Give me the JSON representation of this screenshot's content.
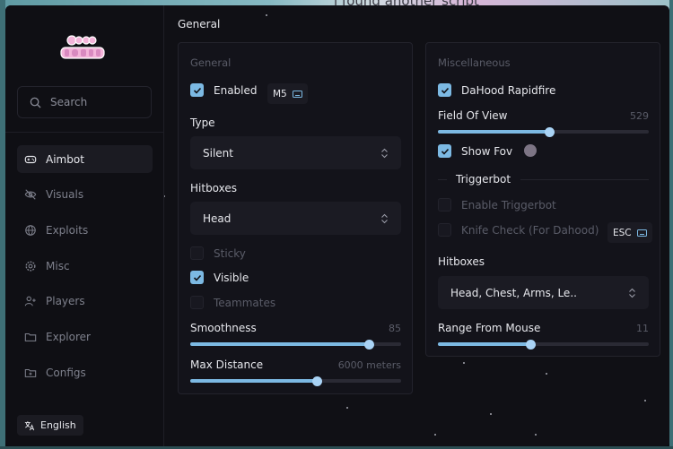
{
  "backdrop": {
    "text": "i found another script"
  },
  "sidebar": {
    "search_placeholder": "Search",
    "items": [
      {
        "label": "Aimbot",
        "icon": "gamepad-icon",
        "active": true
      },
      {
        "label": "Visuals",
        "icon": "eye-off-icon",
        "active": false
      },
      {
        "label": "Exploits",
        "icon": "globe-icon",
        "active": false
      },
      {
        "label": "Misc",
        "icon": "gear-icon",
        "active": false
      },
      {
        "label": "Players",
        "icon": "user-plus-icon",
        "active": false
      },
      {
        "label": "Explorer",
        "icon": "folder-icon",
        "active": false
      },
      {
        "label": "Configs",
        "icon": "folder-plus-icon",
        "active": false
      }
    ],
    "language": "English"
  },
  "page_title": "General",
  "general": {
    "title": "General",
    "enabled": {
      "label": "Enabled",
      "checked": true,
      "key": "M5"
    },
    "type": {
      "label": "Type",
      "value": "Silent"
    },
    "hitboxes": {
      "label": "Hitboxes",
      "value": "Head"
    },
    "sticky": {
      "label": "Sticky",
      "checked": false
    },
    "visible": {
      "label": "Visible",
      "checked": true
    },
    "teammates": {
      "label": "Teammates",
      "checked": false
    },
    "smoothness": {
      "label": "Smoothness",
      "value": "85",
      "fill": 0.847
    },
    "max_distance": {
      "label": "Max Distance",
      "value": "6000 meters",
      "fill": 0.6
    }
  },
  "misc": {
    "title": "Miscellaneous",
    "rapidfire": {
      "label": "DaHood Rapidfire",
      "checked": true
    },
    "fov": {
      "label": "Field Of View",
      "value": "529",
      "fill": 0.529
    },
    "show_fov": {
      "label": "Show Fov",
      "checked": true,
      "color": "#7d7585"
    },
    "triggerbot_header": "Triggerbot",
    "enable_triggerbot": {
      "label": "Enable Triggerbot",
      "checked": false
    },
    "knife_check": {
      "label": "Knife Check (For Dahood)",
      "checked": false,
      "key": "ESC"
    },
    "hitboxes": {
      "label": "Hitboxes",
      "value": "Head, Chest, Arms, Le.."
    },
    "range_from_mouse": {
      "label": "Range From Mouse",
      "value": "11",
      "fill": 0.44
    }
  },
  "colors": {
    "accent": "#7cb9e3",
    "panel": "#13131a",
    "background": "#101015"
  }
}
